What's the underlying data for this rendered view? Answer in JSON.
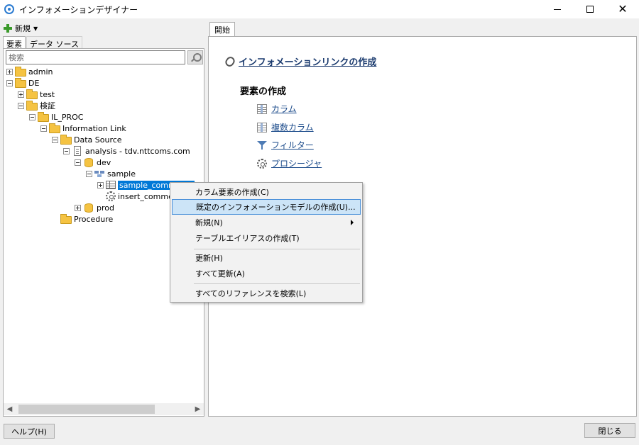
{
  "window": {
    "title": "インフォメーションデザイナー",
    "minimize": "—",
    "maximize": "☐",
    "close": "✕"
  },
  "toolbar": {
    "new_label": "新規",
    "new_caret": "▼"
  },
  "left_tabs": {
    "elements": "要素",
    "data_source": "データ ソース"
  },
  "search": {
    "placeholder": "検索"
  },
  "tree": [
    {
      "label": "admin",
      "icon": "folder-icon",
      "expander": "plus"
    },
    {
      "label": "DE",
      "icon": "folder-icon",
      "expander": "minus"
    },
    {
      "label": "test",
      "icon": "folder-icon",
      "expander": "plus"
    },
    {
      "label": "検証",
      "icon": "folder-icon",
      "expander": "minus"
    },
    {
      "label": "IL_PROC",
      "icon": "folder-icon",
      "expander": "minus"
    },
    {
      "label": "Information Link",
      "icon": "folder-icon",
      "expander": "minus"
    },
    {
      "label": "Data Source",
      "icon": "folder-icon",
      "expander": "minus"
    },
    {
      "label": "analysis - tdv.nttcoms.com",
      "icon": "datasource-icon",
      "expander": "minus"
    },
    {
      "label": "dev",
      "icon": "database-icon",
      "expander": "minus"
    },
    {
      "label": "sample",
      "icon": "schema-icon",
      "expander": "minus"
    },
    {
      "label": "sample_comments",
      "icon": "table-icon",
      "expander": "plus",
      "selected": true
    },
    {
      "label": "insert_comment",
      "icon": "procedure-icon",
      "expander": "none"
    },
    {
      "label": "prod",
      "icon": "database-icon",
      "expander": "plus"
    },
    {
      "label": "Procedure",
      "icon": "folder-icon",
      "expander": "none"
    }
  ],
  "right_tab": {
    "label": "開始"
  },
  "start_page": {
    "link_title": "インフォメーションリンクの作成",
    "section_title": "要素の作成",
    "items": [
      {
        "label": "カラム",
        "icon": "column-icon"
      },
      {
        "label": "複数カラム",
        "icon": "multi-column-icon"
      },
      {
        "label": "フィルター",
        "icon": "filter-icon"
      },
      {
        "label": "プロシージャ",
        "icon": "procedure-icon"
      }
    ]
  },
  "context_menu": {
    "items": [
      {
        "label": "カラム要素の作成(C)"
      },
      {
        "label": "既定のインフォメーションモデルの作成(U)...",
        "highlighted": true
      },
      {
        "label": "新規(N)",
        "submenu": true
      },
      {
        "label": "テーブルエイリアスの作成(T)"
      },
      {
        "label": "更新(H)"
      },
      {
        "label": "すべて更新(A)"
      },
      {
        "label": "すべてのリファレンスを検索(L)"
      }
    ]
  },
  "buttons": {
    "help": "ヘルプ(H)",
    "close": "閉じる"
  },
  "colors": {
    "selection": "#0078d7",
    "menu_highlight": "#cce4f7",
    "link": "#1a4a8a",
    "folder": "#f5c342"
  }
}
